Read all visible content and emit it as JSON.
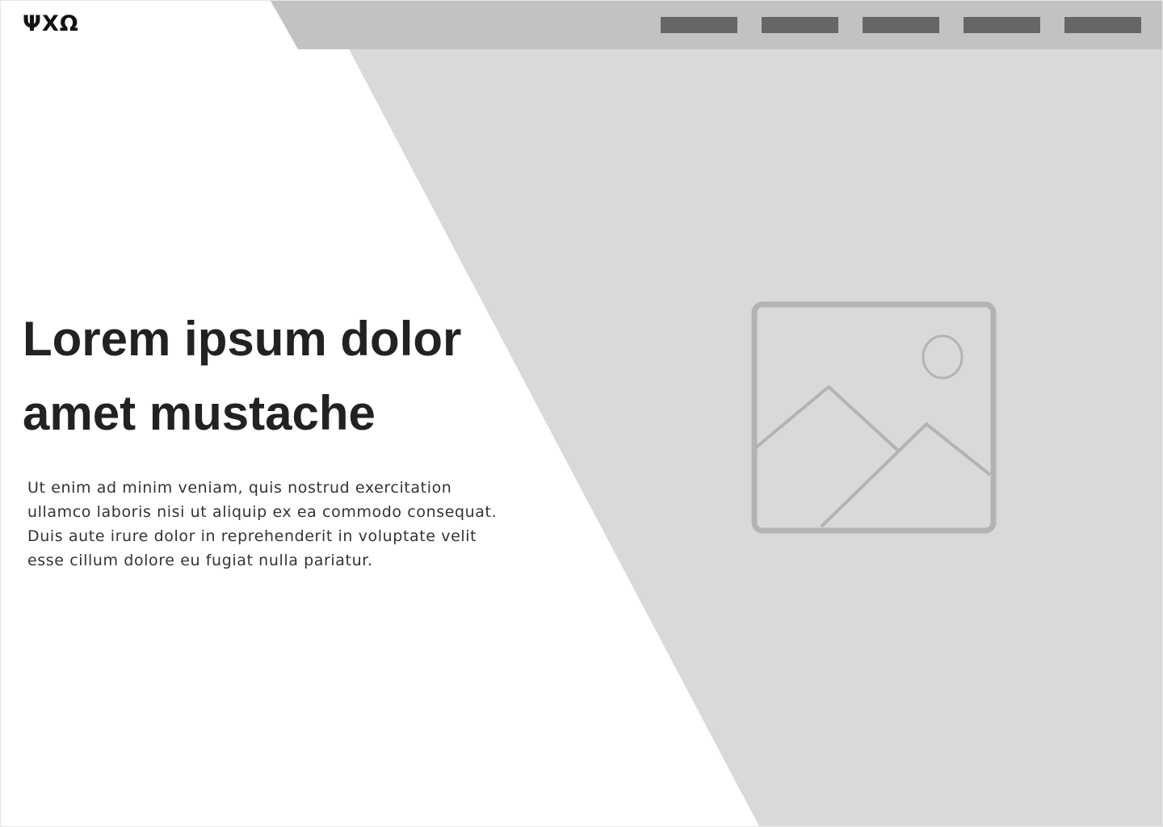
{
  "header": {
    "logo_text": "ΨΧΩ",
    "nav_items": [
      {
        "name": "nav-item-1"
      },
      {
        "name": "nav-item-2"
      },
      {
        "name": "nav-item-3"
      },
      {
        "name": "nav-item-4"
      },
      {
        "name": "nav-item-5"
      }
    ]
  },
  "hero": {
    "headline_line1": "Lorem ipsum dolor",
    "headline_line2": "amet mustache",
    "body_line1": "Ut enim ad minim veniam, quis nostrud exercitation",
    "body_line2": "ullamco laboris nisi ut aliquip ex ea commodo consequat.",
    "body_line3": "Duis aute irure dolor in reprehenderit in voluptate velit",
    "body_line4": "esse cillum dolore eu fugiat nulla pariatur.",
    "image_icon": "image-placeholder-icon"
  },
  "colors": {
    "topbar": "#c2c2c2",
    "hero_panel": "#d9d9d9",
    "nav_block": "#666666",
    "headline": "#222222",
    "placeholder_stroke": "#b3b3b3"
  }
}
